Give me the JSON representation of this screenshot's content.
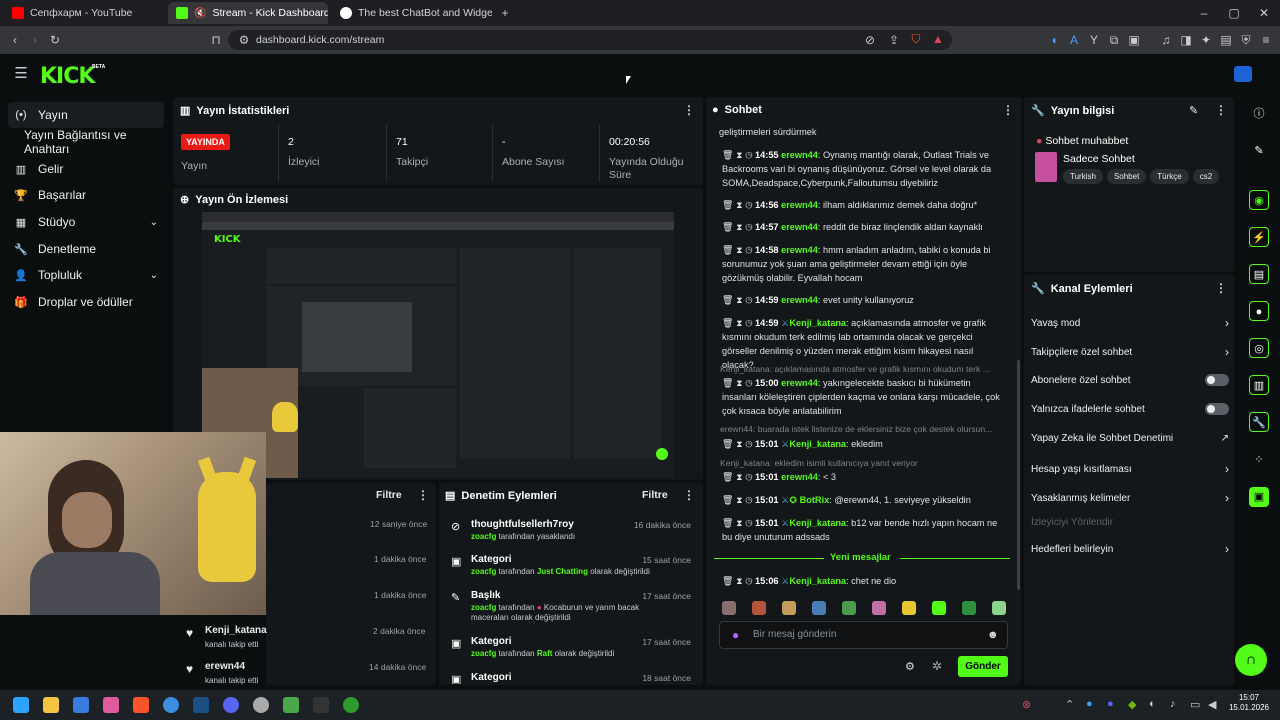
{
  "browser": {
    "tabs": [
      {
        "title": "Сепфхарм - YouTube",
        "fav": "#ff0000"
      },
      {
        "title": "Stream - Kick Dashboard",
        "fav": "#53fc18"
      },
      {
        "title": "The best ChatBot and Widgets for Kick",
        "fav": "#ffffff"
      }
    ],
    "url": "dashboard.kick.com/stream"
  },
  "brand": {
    "logo": "KICK",
    "badge": "BETA",
    "accent": "#53fc18"
  },
  "sidebar": {
    "items": [
      {
        "label": "Yayın",
        "icon": "broadcast-icon"
      },
      {
        "label": "Yayın Bağlantısı ve Anahtarı",
        "icon": ""
      },
      {
        "label": "Gelir",
        "icon": "chart-icon"
      },
      {
        "label": "Başarılar",
        "icon": "trophy-icon"
      },
      {
        "label": "Stüdyo",
        "icon": "studio-icon"
      },
      {
        "label": "Denetleme",
        "icon": "wrench-icon"
      },
      {
        "label": "Topluluk",
        "icon": "community-icon"
      },
      {
        "label": "Droplar ve ödüller",
        "icon": "gift-icon"
      }
    ]
  },
  "stats": {
    "title": "Yayın İstatistikleri",
    "live_badge": "YAYINDA",
    "live_label": "Yayın",
    "items": [
      {
        "value": "2",
        "label": "İzleyici"
      },
      {
        "value": "71",
        "label": "Takipçi"
      },
      {
        "value": "-",
        "label": "Abone Sayısı"
      },
      {
        "value": "00:20:56",
        "label": "Yayında Olduğu Süre"
      }
    ]
  },
  "preview": {
    "title": "Yayın Ön İzlemesi"
  },
  "activity": {
    "filter": "Filtre",
    "items": [
      {
        "user": "",
        "sub": "",
        "time": "12 saniye önce"
      },
      {
        "user": "",
        "sub": "",
        "time": "1 dakika önce"
      },
      {
        "user": "",
        "sub": "",
        "time": "1 dakika önce"
      },
      {
        "user": "Kenji_katana",
        "sub": "kanalı takip etti",
        "time": "2 dakika önce"
      },
      {
        "user": "erewn44",
        "sub": "kanalı takip etti",
        "time": "14 dakika önce"
      }
    ]
  },
  "moderation": {
    "title": "Denetim Eylemleri",
    "filter": "Filtre",
    "items": [
      {
        "title": "thoughtfulsellerh7roy",
        "mod": "zoacfg",
        "pre": "tarafından yasaklandı",
        "hl": "",
        "post": "",
        "time": "16 dakika önce"
      },
      {
        "title": "Kategori",
        "mod": "zoacfg",
        "pre": "tarafından",
        "hl": "Just Chatting",
        "post": "olarak değiştirildi",
        "time": "15 saat önce"
      },
      {
        "title": "Başlık",
        "mod": "zoacfg",
        "pre": "tarafından",
        "hl": "",
        "post": "Kocaburun ve yarım bacak maceraları olarak değiştirildi",
        "time": "17 saat önce"
      },
      {
        "title": "Kategori",
        "mod": "zoacfg",
        "pre": "tarafından",
        "hl": "Raft",
        "post": "olarak değiştirildi",
        "time": "17 saat önce"
      },
      {
        "title": "Kategori",
        "mod": "",
        "pre": "",
        "hl": "",
        "post": "",
        "time": "18 saat önce"
      }
    ]
  },
  "chat": {
    "title": "Sohbet",
    "top_fragment": "geliştirmeleri sürdürmek",
    "messages": [
      {
        "time": "14:55",
        "user": "erewn44",
        "text": "Oynanış mantığı olarak, Outlast Trials ve Backrooms vari bi oynanış düşünüyoruz. Görsel ve level olarak da SOMA,Deadspace,Cyberpunk,Falloutumsu diyebiliriz"
      },
      {
        "time": "14:56",
        "user": "erewn44",
        "text": "ilham aldıklarımız demek daha doğru*"
      },
      {
        "time": "14:57",
        "user": "erewn44",
        "text": "reddit de biraz linçlendik aldan kaynaklı"
      },
      {
        "time": "14:58",
        "user": "erewn44",
        "text": "hmm anladım anladım, tabiki o konuda bi sorunumuz yok şuan ama geliştirmeler devam ettiği için öyle gözükmüş olabilir. Eyvallah hocam"
      },
      {
        "time": "14:59",
        "user": "erewn44",
        "text": "evet unity kullanıyoruz"
      },
      {
        "time": "14:59",
        "user": "Kenji_katana",
        "text": "açıklamasında atmosfer ve grafik kısmını okudum terk edilmiş lab ortamında olacak ve gerçekci görseller denilmiş o yüzden merak ettiğim kısım hikayesi nasıl olacak?"
      },
      {
        "time": "15:00",
        "user": "erewn44",
        "text": "yakıngelecekte baskıcı bi hükümetin insanları köleleştiren çiplerden kaçma ve onlara karşı mücadele, çok çok kısaca böyle anlatabilirim"
      },
      {
        "time": "15:01",
        "user": "Kenji_katana",
        "text": "ekledim"
      },
      {
        "time": "15:01",
        "user": "erewn44",
        "text": "< 3"
      },
      {
        "time": "15:01",
        "user": "BotRix",
        "text": "@erewn44, 1. seviyeye yükseldin"
      },
      {
        "time": "15:01",
        "user": "Kenji_katana",
        "text": "b12 var bende hızlı yapın hocam ne bu diye unuturum adssads"
      },
      {
        "time": "15:06",
        "user": "Kenji_katana",
        "text": "chet ne dio"
      }
    ],
    "replies": [
      "Kenji_katana: açıklamasında atmosfer ve grafik kısmını okudum terk ...",
      "erewn44: buarada istek listenize de eklersiniz bize çok destek olursun...",
      "Kenji_katana: ekledim isimli kullanıcıya yanıt veriyor"
    ],
    "new_messages": "Yeni mesajlar",
    "input_placeholder": "Bir mesaj gönderin",
    "send": "Gönder"
  },
  "stream_info": {
    "title": "Yayın bilgisi",
    "stream_title": "Sohbet muhabbet",
    "category": "Sadece Sohbet",
    "tags": [
      "Turkish",
      "Sohbet",
      "Türkçe",
      "cs2"
    ]
  },
  "channel_actions": {
    "title": "Kanal Eylemleri",
    "items": [
      {
        "label": "Yavaş mod",
        "type": "chevron"
      },
      {
        "label": "Takipçilere özel sohbet",
        "type": "chevron"
      },
      {
        "label": "Abonelere özel sohbet",
        "type": "toggle"
      },
      {
        "label": "Yalnızca ifadelerle sohbet",
        "type": "toggle"
      },
      {
        "label": "Yapay Zeka ile Sohbet Denetimi",
        "type": "external"
      },
      {
        "label": "Hesap yaşı kısıtlaması",
        "type": "chevron"
      },
      {
        "label": "Yasaklanmış kelimeler",
        "type": "chevron"
      },
      {
        "label": "İzleyiciyi Yönlendir",
        "type": "disabled"
      },
      {
        "label": "Hedefleri belirleyin",
        "type": "chevron"
      }
    ]
  },
  "taskbar": {
    "time": "15:07",
    "date": "15.01.2026"
  }
}
